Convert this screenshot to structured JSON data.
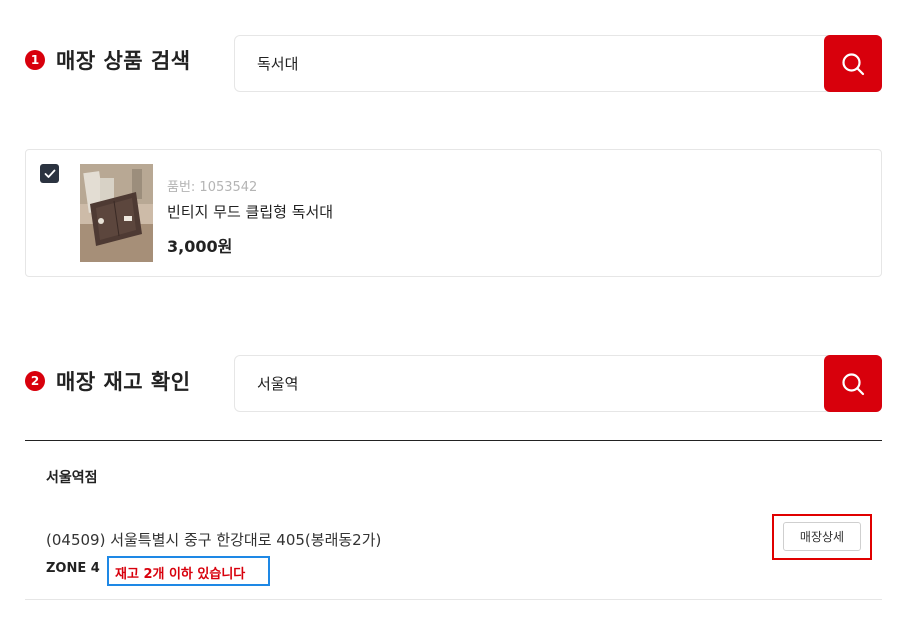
{
  "section1": {
    "badge": "1",
    "title": "매장 상품 검색",
    "search_value": "독서대"
  },
  "product": {
    "checked": true,
    "product_no": "품번: 1053542",
    "name": "빈티지 무드 클립형 독서대",
    "price": "3,000원"
  },
  "section2": {
    "badge": "2",
    "title": "매장 재고 확인",
    "search_value": "서울역"
  },
  "store": {
    "name": "서울역점",
    "address": "(04509) 서울특별시 중구 한강대로 405(봉래동2가)",
    "zone": "ZONE 4",
    "stock_status": "재고 2개 이하 있습니다",
    "detail_button": "매장상세"
  },
  "colors": {
    "accent": "#d8000c",
    "checkbox": "#2b3340",
    "highlight_blue": "#1e88e5",
    "highlight_red": "#e00000"
  },
  "icons": {
    "search": "search-icon",
    "check": "check-icon"
  }
}
